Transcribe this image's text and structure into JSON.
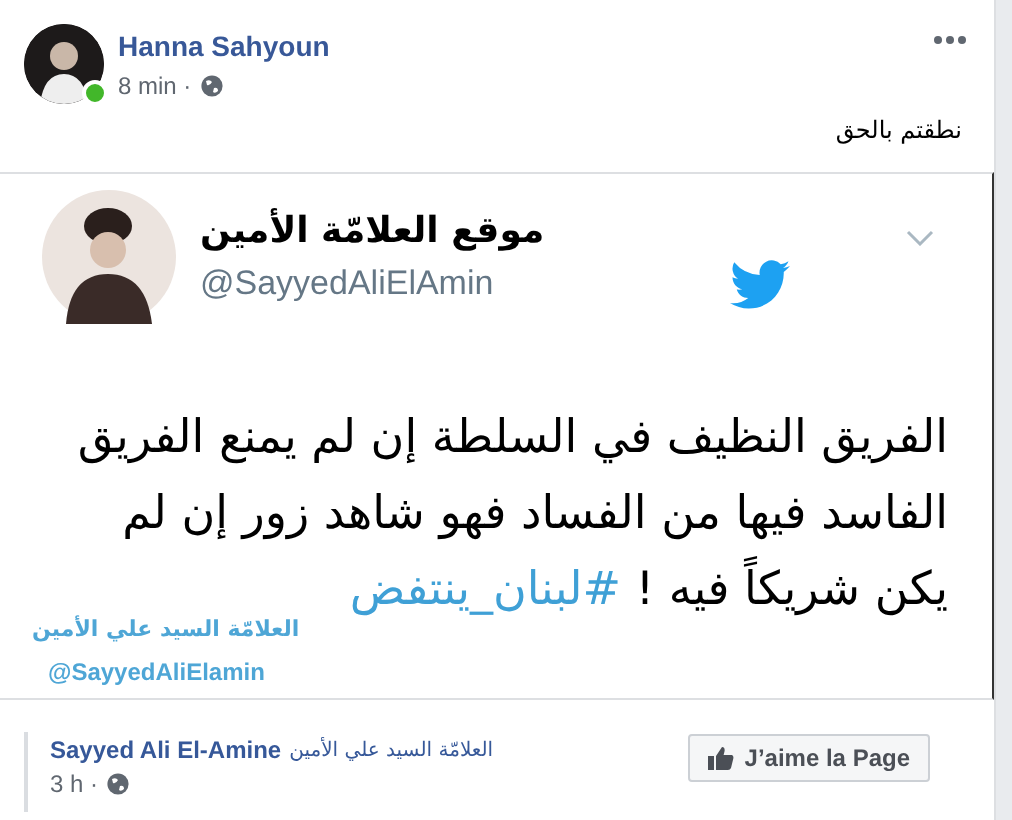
{
  "post": {
    "author": "Hanna Sahyoun",
    "online": true,
    "time": "8 min ·",
    "text": "نطقتم بالحق"
  },
  "tweet": {
    "name": "موقع العلامّة الأمين",
    "handle": "@SayyedAliElAmin",
    "lines": [
      "الفريق النظيف في السلطة إن لم يمنع الفريق",
      "الفاسد فيها من الفساد فهو شاهد زور إن لم",
      "يكن شريكاً فيه !"
    ],
    "hashtag": "#لبنان_ينتفض",
    "signature_name": "العلامّة السيد علي الأمين",
    "signature_handle": "@SayyedAliElamin"
  },
  "shared_from": {
    "page_name": "Sayyed Ali El-Amine",
    "page_name_arabic": "العلامّة السيد علي الأمين",
    "time": "3 h ·",
    "like_button": "J’aime la Page"
  }
}
